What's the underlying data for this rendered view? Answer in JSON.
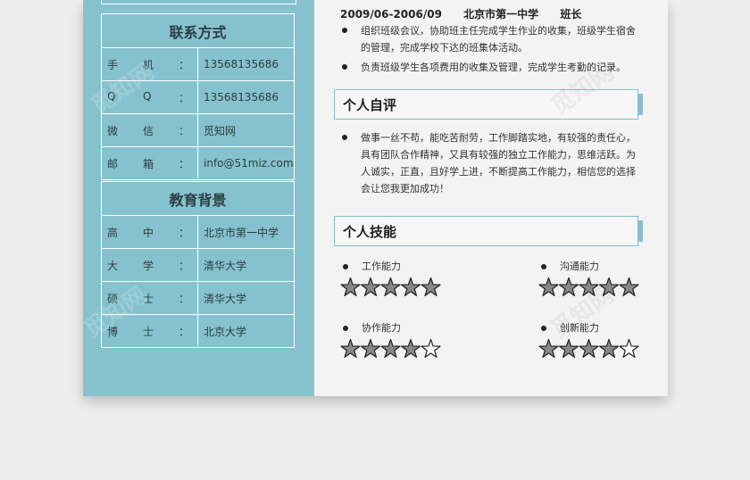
{
  "contact": {
    "title": "联系方式",
    "rows": [
      {
        "label_chars": [
          "手",
          "机",
          "："
        ],
        "value": "13568135686"
      },
      {
        "label_chars": [
          "Q",
          "Q",
          "："
        ],
        "value": "13568135686"
      },
      {
        "label_chars": [
          "微",
          "信",
          "："
        ],
        "value": "觅知网"
      },
      {
        "label_chars": [
          "邮",
          "箱",
          "："
        ],
        "value": "info@51miz.com"
      }
    ]
  },
  "education": {
    "title": "教育背景",
    "rows": [
      {
        "label_chars": [
          "高",
          "中",
          "："
        ],
        "value": "北京市第一中学"
      },
      {
        "label_chars": [
          "大",
          "学",
          "："
        ],
        "value": "清华大学"
      },
      {
        "label_chars": [
          "硕",
          "士",
          "："
        ],
        "value": "清华大学"
      },
      {
        "label_chars": [
          "博",
          "士",
          "："
        ],
        "value": "北京大学"
      }
    ]
  },
  "experience": {
    "period": "2009/06-2006/09",
    "org": "北京市第一中学",
    "role": "班长",
    "bullets": [
      "组织班级会议，协助班主任完成学生作业的收集，班级学生宿舍的管理，完成学校下达的班集体活动。",
      "负责班级学生各项费用的收集及管理，完成学生考勤的记录。"
    ]
  },
  "self_eval": {
    "title": "个人自评",
    "text": "做事一丝不苟，能吃苦耐劳，工作脚踏实地，有较强的责任心，具有团队合作精神，又具有较强的独立工作能力，思维活跃。为人诚实，正直，且好学上进，不断提高工作能力，相信您的选择会让您我更加成功！"
  },
  "skills": {
    "title": "个人技能",
    "items": [
      {
        "name": "工作能力",
        "rating": 5,
        "max": 5
      },
      {
        "name": "沟通能力",
        "rating": 5,
        "max": 5
      },
      {
        "name": "协作能力",
        "rating": 4,
        "max": 5
      },
      {
        "name": "创新能力",
        "rating": 4,
        "max": 5
      }
    ]
  },
  "watermark": "觅知网",
  "colors": {
    "sidebar": "#86c2cd",
    "panel": "#f3f3f3",
    "accent": "#7fc0ca",
    "star_fill": "#888888",
    "star_stroke": "#222222"
  }
}
